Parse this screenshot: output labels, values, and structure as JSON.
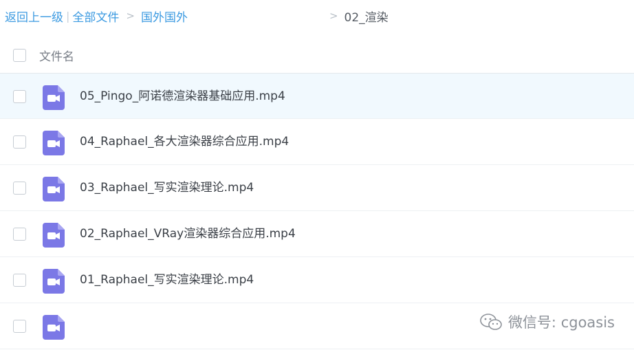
{
  "breadcrumb": {
    "back_label": "返回上一级",
    "all_files_label": "全部文件",
    "folder_label": "国外国外",
    "current_label": "02_渲染"
  },
  "header": {
    "name_column": "文件名"
  },
  "files": [
    {
      "name": "05_Pingo_阿诺德渲染器基础应用.mp4",
      "icon": "video-file-icon",
      "selected": true
    },
    {
      "name": "04_Raphael_各大渲染器综合应用.mp4",
      "icon": "video-file-icon",
      "selected": false
    },
    {
      "name": "03_Raphael_写实渲染理论.mp4",
      "icon": "video-file-icon",
      "selected": false
    },
    {
      "name": "02_Raphael_VRay渲染器综合应用.mp4",
      "icon": "video-file-icon",
      "selected": false
    },
    {
      "name": "01_Raphael_写实渲染理论.mp4",
      "icon": "video-file-icon",
      "selected": false
    },
    {
      "name": "",
      "icon": "video-file-icon",
      "selected": false
    }
  ],
  "watermark": {
    "text": "微信号: cgoasis",
    "icon": "wechat-icon"
  },
  "colors": {
    "link": "#3b9ae1",
    "icon_purple": "#7b78e6",
    "selected_row": "#f1f9fe"
  }
}
